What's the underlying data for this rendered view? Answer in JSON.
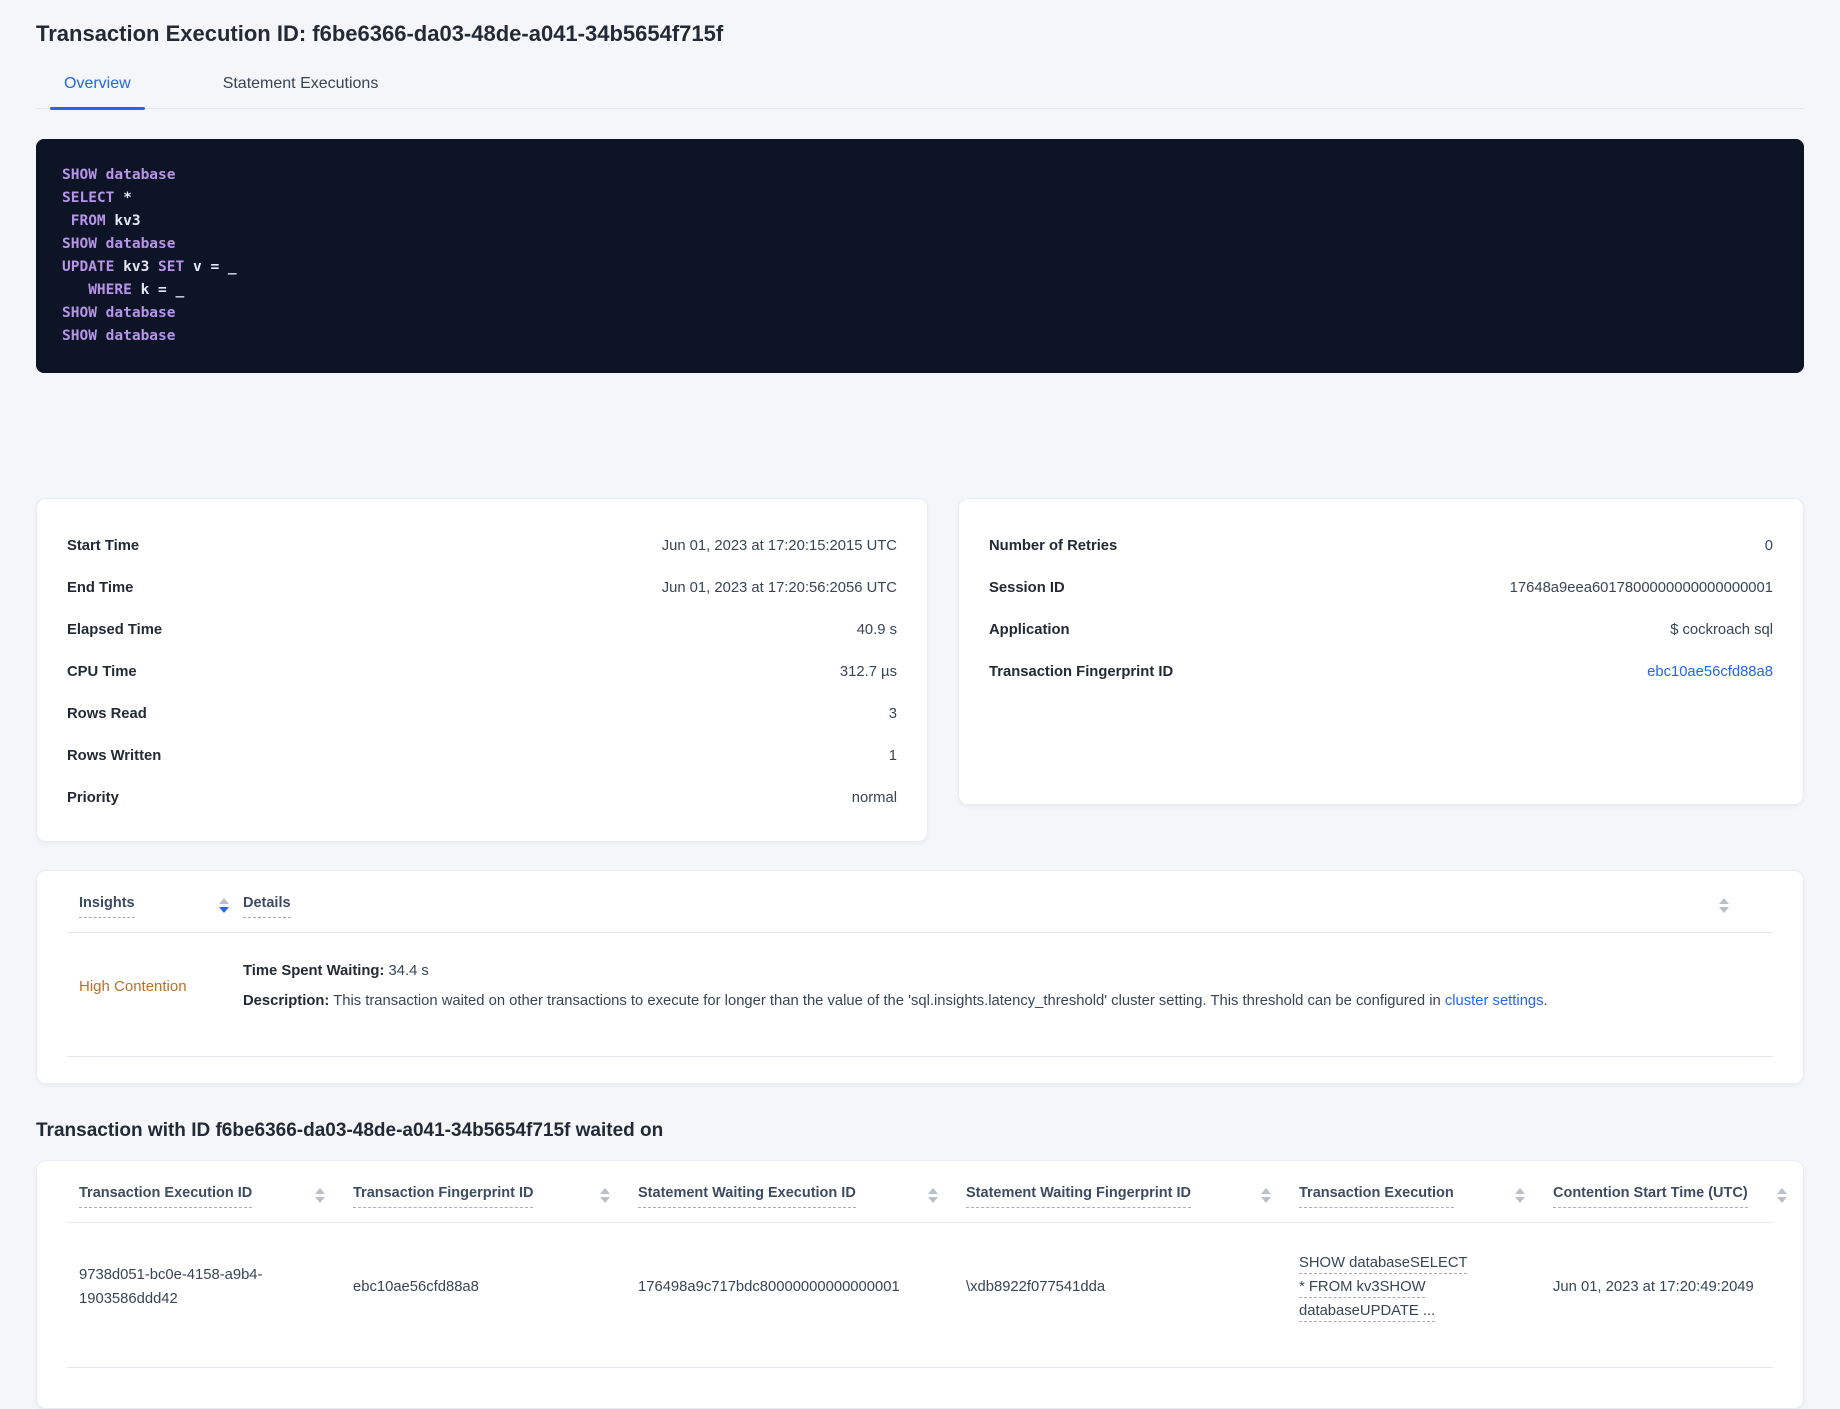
{
  "header": {
    "title": "Transaction Execution ID: f6be6366-da03-48de-a041-34b5654f715f",
    "tabs": [
      {
        "label": "Overview",
        "active": true
      },
      {
        "label": "Statement Executions",
        "active": false
      }
    ]
  },
  "sql": {
    "lines": [
      [
        {
          "t": "SHOW",
          "c": "kw"
        },
        {
          "t": " ",
          "c": "pl"
        },
        {
          "t": "database",
          "c": "kw"
        }
      ],
      [
        {
          "t": "SELECT",
          "c": "kw"
        },
        {
          "t": " *",
          "c": "pl"
        }
      ],
      [
        {
          "t": " ",
          "c": "pl"
        },
        {
          "t": "FROM",
          "c": "kw"
        },
        {
          "t": " kv3",
          "c": "pl"
        }
      ],
      [
        {
          "t": "SHOW",
          "c": "kw"
        },
        {
          "t": " ",
          "c": "pl"
        },
        {
          "t": "database",
          "c": "kw"
        }
      ],
      [
        {
          "t": "UPDATE",
          "c": "kw"
        },
        {
          "t": " kv3 ",
          "c": "pl"
        },
        {
          "t": "SET",
          "c": "kw"
        },
        {
          "t": " v = _",
          "c": "pl"
        }
      ],
      [
        {
          "t": "   ",
          "c": "pl"
        },
        {
          "t": "WHERE",
          "c": "kw"
        },
        {
          "t": " k = _",
          "c": "pl"
        }
      ],
      [
        {
          "t": "SHOW",
          "c": "kw"
        },
        {
          "t": " ",
          "c": "pl"
        },
        {
          "t": "database",
          "c": "kw"
        }
      ],
      [
        {
          "t": "SHOW",
          "c": "kw"
        },
        {
          "t": " ",
          "c": "pl"
        },
        {
          "t": "database",
          "c": "kw"
        }
      ]
    ]
  },
  "summary_card": {
    "rows": [
      {
        "label": "Start Time",
        "value": "Jun 01, 2023 at 17:20:15:2015 UTC"
      },
      {
        "label": "End Time",
        "value": "Jun 01, 2023 at 17:20:56:2056 UTC"
      },
      {
        "label": "Elapsed Time",
        "value": "40.9 s"
      },
      {
        "label": "CPU Time",
        "value": "312.7 µs"
      },
      {
        "label": "Rows Read",
        "value": "3"
      },
      {
        "label": "Rows Written",
        "value": "1"
      },
      {
        "label": "Priority",
        "value": "normal"
      }
    ]
  },
  "session_card": {
    "rows": [
      {
        "label": "Number of Retries",
        "value": "0"
      },
      {
        "label": "Session ID",
        "value": "17648a9eea6017800000000000000001"
      },
      {
        "label": "Application",
        "value": "$ cockroach sql"
      },
      {
        "label": "Transaction Fingerprint ID",
        "value": "ebc10ae56cfd88a8",
        "link": true
      }
    ]
  },
  "insights": {
    "columns": {
      "insights_label": "Insights",
      "details_label": "Details"
    },
    "row": {
      "insight": "High Contention",
      "waiting_label": "Time Spent Waiting:",
      "waiting_value": " 34.4 s",
      "description_label": "Description:",
      "description_text": " This transaction waited on other transactions to execute for longer than the value of the 'sql.insights.latency_threshold' cluster setting. This threshold can be configured in ",
      "description_link": "cluster settings",
      "description_suffix": "."
    }
  },
  "waited_on": {
    "heading": "Transaction with ID f6be6366-da03-48de-a041-34b5654f715f waited on",
    "columns": [
      "Transaction Execution ID",
      "Transaction Fingerprint ID",
      "Statement Waiting Execution ID",
      "Statement Waiting Fingerprint ID",
      "Transaction Execution",
      "Contention Start Time (UTC)"
    ],
    "row": {
      "transaction_execution_id": "9738d051-bc0e-4158-a9b4-1903586ddd42",
      "transaction_fingerprint_id": "ebc10ae56cfd88a8",
      "statement_waiting_execution_id": "176498a9c717bdc80000000000000001",
      "statement_waiting_fingerprint_id": "\\xdb8922f077541dda",
      "transaction_execution": "SHOW databaseSELECT * FROM kv3SHOW databaseUPDATE ...",
      "contention_start_time": "Jun 01, 2023 at 17:20:49:2049"
    }
  },
  "colors": {
    "accent_blue": "#2566eb",
    "code_background": "#0d1426",
    "code_keyword": "#b794e8",
    "code_plain": "#e3e8f4",
    "insight_warning": "#bf6e26",
    "page_background": "#f4f6fa"
  }
}
